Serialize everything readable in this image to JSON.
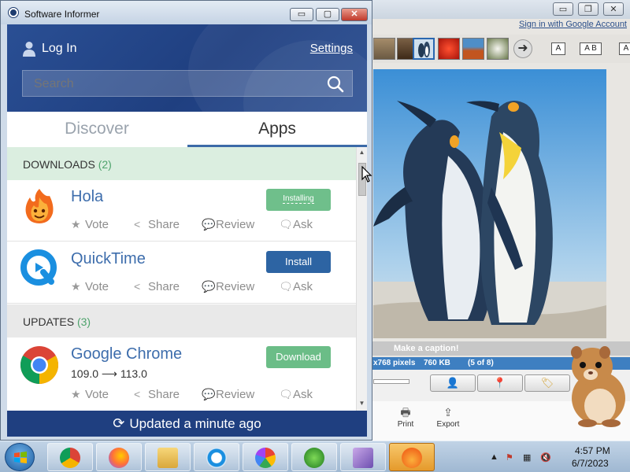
{
  "window": {
    "title": "Software Informer",
    "minimize": "▭",
    "maximize": "▢",
    "close": "✕"
  },
  "header": {
    "login_label": "Log In",
    "settings_label": "Settings",
    "search_placeholder": "Search"
  },
  "tabs": [
    {
      "label": "Discover",
      "active": false
    },
    {
      "label": "Apps",
      "active": true
    }
  ],
  "downloads": {
    "title": "DOWNLOADS",
    "count": "(2)",
    "items": [
      {
        "name": "Hola",
        "button": "Installing",
        "actions": [
          "Vote",
          "Share",
          "Review",
          "Ask"
        ]
      },
      {
        "name": "QuickTime",
        "button": "Install",
        "actions": [
          "Vote",
          "Share",
          "Review",
          "Ask"
        ]
      }
    ]
  },
  "updates": {
    "title": "UPDATES",
    "count": "(3)",
    "items": [
      {
        "name": "Google Chrome",
        "version": "109.0 ⟶ 113.0",
        "button": "Download",
        "actions": [
          "Vote",
          "Share",
          "Review",
          "Ask"
        ]
      }
    ]
  },
  "status": {
    "text": "Updated a minute ago"
  },
  "background_app": {
    "signin_link": "Sign in with Google Account",
    "text_buttons": [
      "A",
      "A B",
      "A"
    ],
    "caption_placeholder": "Make a caption!",
    "info_dims": "x768 pixels",
    "info_size": "760 KB",
    "info_index": "(5 of 8)",
    "bottom_buttons": [
      "Print",
      "Export"
    ]
  },
  "taskbar": {
    "time": "4:57 PM",
    "date": "6/7/2023"
  },
  "colors": {
    "header_blue": "#1f3f80",
    "link_blue": "#3d6dac",
    "install_blue": "#2d64a3",
    "green": "#6bbd87"
  }
}
